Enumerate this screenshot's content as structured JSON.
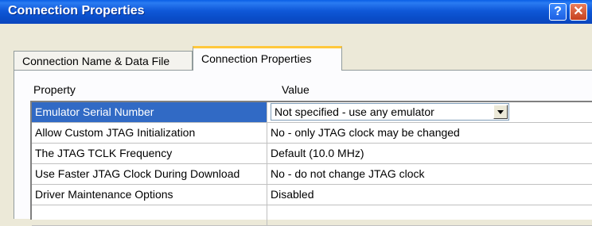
{
  "window": {
    "title": "Connection Properties",
    "help_label": "?",
    "close_label": "✕"
  },
  "tabs": [
    {
      "label": "Connection Name & Data File",
      "active": false
    },
    {
      "label": "Connection Properties",
      "active": true
    }
  ],
  "grid": {
    "columns": [
      "Property",
      "Value"
    ],
    "rows": [
      {
        "property": "Emulator Serial Number",
        "value": "Not specified - use any emulator",
        "selected": true
      },
      {
        "property": "Allow Custom JTAG Initialization",
        "value": "No - only JTAG clock may be changed"
      },
      {
        "property": "The JTAG TCLK Frequency",
        "value": "Default (10.0 MHz)"
      },
      {
        "property": "Use Faster JTAG Clock During Download",
        "value": "No - do not change JTAG clock"
      },
      {
        "property": "Driver Maintenance Options",
        "value": "Disabled"
      },
      {
        "property": "",
        "value": ""
      }
    ]
  },
  "colors": {
    "titlebar": "#0a4fcb",
    "selection": "#316ac5",
    "tab_highlight": "#ffc83c"
  },
  "icons": [
    "help-icon",
    "close-icon",
    "dropdown-arrow-icon"
  ]
}
